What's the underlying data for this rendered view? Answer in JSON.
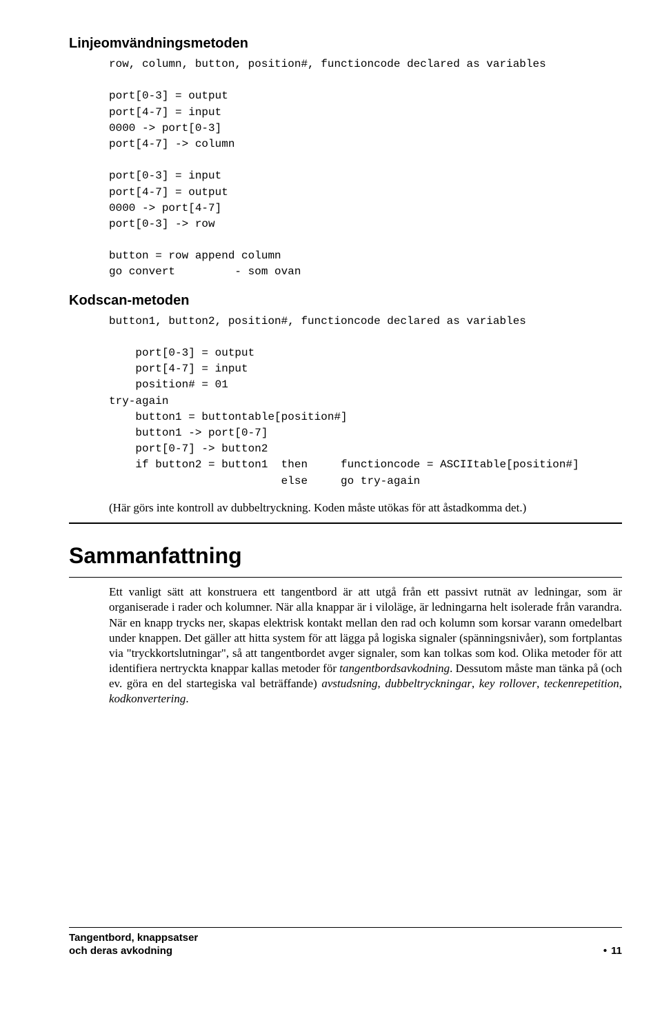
{
  "section1": {
    "heading": "Linjeomvändningsmetoden",
    "code": "row, column, button, position#, functioncode declared as variables\n\nport[0-3] = output\nport[4-7] = input\n0000 -> port[0-3]\nport[4-7] -> column\n\nport[0-3] = input\nport[4-7] = output\n0000 -> port[4-7]\nport[0-3] -> row\n\nbutton = row append column\ngo convert         - som ovan"
  },
  "section2": {
    "heading": "Kodscan-metoden",
    "code": "button1, button2, position#, functioncode declared as variables\n\n    port[0-3] = output\n    port[4-7] = input\n    position# = 01\ntry-again\n    button1 = buttontable[position#]\n    button1 -> port[0-7]\n    port[0-7] -> button2\n    if button2 = button1  then     functioncode = ASCIItable[position#]\n                          else     go try-again",
    "note": "(Här görs inte kontroll av dubbeltryckning. Koden måste utökas för att åstadkomma det.)"
  },
  "summary": {
    "heading": "Sammanfattning",
    "para_html": "Ett vanligt sätt att konstruera ett tangentbord är att utgå från ett passivt rutnät av ledningar, som är organiserade i rader och kolumner. När alla knappar är i viloläge, är ledningarna helt isolerade från varandra. När en knapp trycks ner, skapas elektrisk kontakt mellan den rad och kolumn som korsar varann omedelbart under knappen. Det gäller att hitta system för att lägga på logiska signaler (spänningsnivåer), som fortplantas via \"tryckkortslutningar\", så att tangentbordet avger signaler, som kan tolkas som kod. Olika metoder för att identifiera nertryckta knappar kallas metoder för <span class=\"italic\">tangentbordsavkodning</span>. Dessutom måste man tänka på (och ev. göra en del startegiska val beträffande) <span class=\"italic\">avstudsning</span>, <span class=\"italic\">dubbeltryckningar</span>, <span class=\"italic\">key rollover</span>, <span class=\"italic\">teckenrepetition</span>, <span class=\"italic\">kodkonvertering</span>."
  },
  "footer": {
    "line1": "Tangentbord, knappsatser",
    "line2": "och deras avkodning",
    "page": "11"
  }
}
